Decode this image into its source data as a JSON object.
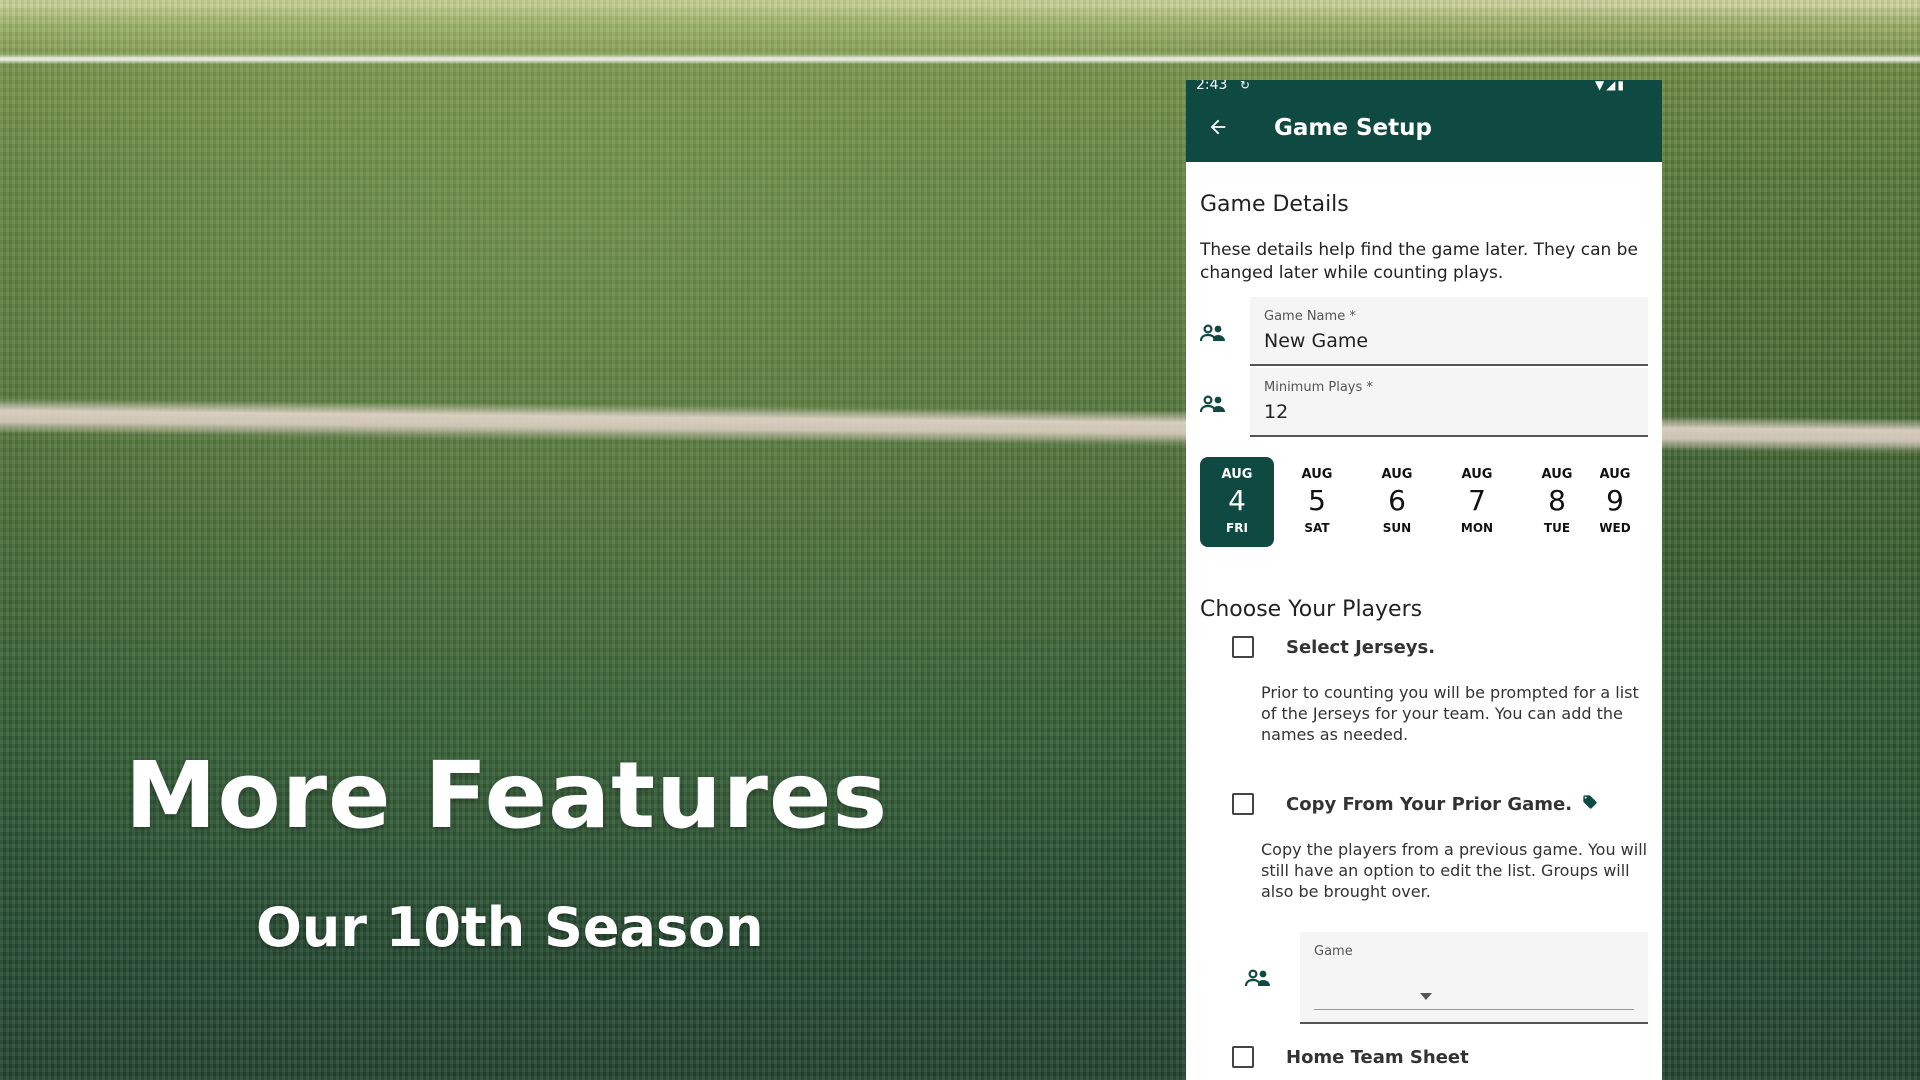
{
  "promo": {
    "title": "More Features",
    "subtitle": "Our 10th Season"
  },
  "status_bar": {
    "time": "2:43",
    "sync_glyph": "↻",
    "icons": "▼◢▮"
  },
  "app_bar": {
    "back_icon": "arrow-left-icon",
    "title": "Game Setup"
  },
  "game_details": {
    "heading": "Game Details",
    "description": "These details help find the game later. They can be changed later while counting plays.",
    "fields": [
      {
        "label": "Game Name *",
        "value": "New Game",
        "icon": "people-icon"
      },
      {
        "label": "Minimum Plays *",
        "value": "12",
        "icon": "people-icon"
      }
    ]
  },
  "dates": [
    {
      "month": "AUG",
      "day": "4",
      "weekday": "FRI",
      "selected": true
    },
    {
      "month": "AUG",
      "day": "5",
      "weekday": "SAT",
      "selected": false
    },
    {
      "month": "AUG",
      "day": "6",
      "weekday": "SUN",
      "selected": false
    },
    {
      "month": "AUG",
      "day": "7",
      "weekday": "MON",
      "selected": false
    },
    {
      "month": "AUG",
      "day": "8",
      "weekday": "TUE",
      "selected": false
    },
    {
      "month": "AUG",
      "day": "9",
      "weekday": "WED",
      "selected": false
    }
  ],
  "players": {
    "heading": "Choose Your Players",
    "options": [
      {
        "label": "Select Jerseys.",
        "checked": false,
        "description": "Prior to counting you will be prompted for a list of the Jerseys for your team. You can add the names as needed."
      },
      {
        "label": "Copy From Your Prior Game.",
        "checked": false,
        "tag_icon": "tag-icon",
        "description": "Copy the players from a previous game. You will still have an option to edit the list. Groups will also be brought over."
      }
    ],
    "game_select": {
      "label": "Game",
      "value": ""
    },
    "next_option_label": "Home Team Sheet"
  },
  "colors": {
    "primary": "#0e4a42"
  }
}
